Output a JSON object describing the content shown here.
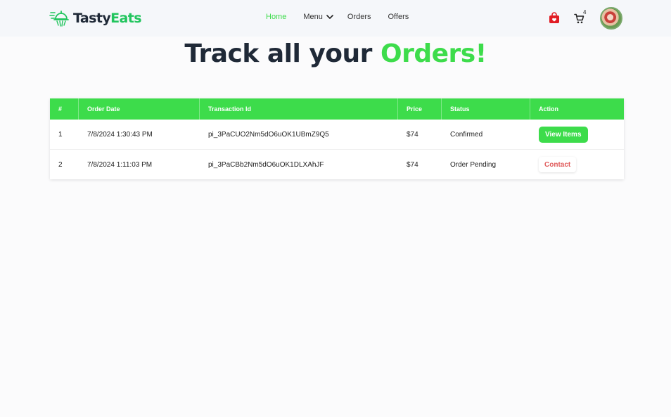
{
  "brand": {
    "name_part1": "Tasty",
    "name_part2": "Eats",
    "icon": "cloche-logo-icon",
    "accent_color": "#22c55e"
  },
  "nav": {
    "home": "Home",
    "menu": "Menu",
    "orders": "Orders",
    "offers": "Offers",
    "active_color": "#3ddc4b"
  },
  "header_icons": {
    "bag": "shopping-bag-icon",
    "cart": "cart-icon",
    "cart_count": "4",
    "avatar": "avatar"
  },
  "title": {
    "part1": "Track all your ",
    "part2": "Orders!"
  },
  "table": {
    "header_color": "#3ddc4b",
    "columns": [
      "#",
      "Order Date",
      "Transaction Id",
      "Price",
      "Status",
      "Action"
    ],
    "rows": [
      {
        "index": "1",
        "date": "7/8/2024 1:30:43 PM",
        "transaction_id": "pi_3PaCUO2Nm5dO6uOK1UBmZ9Q5",
        "price": "$74",
        "status": "Confirmed",
        "action": "View Items"
      },
      {
        "index": "2",
        "date": "7/8/2024 1:11:03 PM",
        "transaction_id": "pi_3PaCBb2Nm5dO6uOK1DLXAhJF",
        "price": "$74",
        "status": "Order Pending",
        "action": "Contact"
      }
    ]
  }
}
